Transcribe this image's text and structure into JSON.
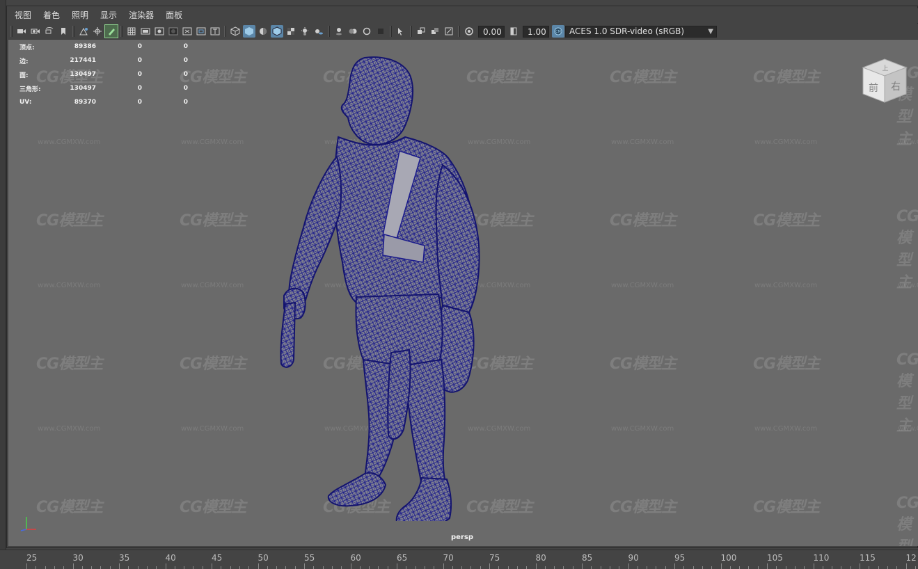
{
  "menubar": {
    "items": [
      "视图",
      "着色",
      "照明",
      "显示",
      "渲染器",
      "面板"
    ]
  },
  "toolbar": {
    "exposure_value": "0.00",
    "gamma_value": "1.00",
    "color_space": "ACES 1.0 SDR-video (sRGB)",
    "icons": [
      "select-camera-icon",
      "camera-attributes-icon",
      "bookmark-icon",
      "image-plane-icon",
      "2d-pan-zoom-icon",
      "grease-pencil-icon",
      "grid-icon",
      "film-gate-icon",
      "resolution-gate-icon",
      "gate-mask-icon",
      "field-chart-icon",
      "safe-action-icon",
      "safe-title-icon",
      "wireframe-icon",
      "smooth-shade-icon",
      "default-material-icon",
      "shaded-wireframe-icon",
      "textured-icon",
      "use-lights-icon",
      "shadows-icon",
      "screen-space-ao-icon",
      "motion-blur-icon",
      "multisample-aa-icon",
      "depth-of-field-icon",
      "isolate-select-icon",
      "xray-icon",
      "xray-joints-icon",
      "backface-culling-icon",
      "exposure-icon",
      "gamma-icon",
      "color-management-icon"
    ]
  },
  "hud": {
    "rows": [
      {
        "label": "顶点:",
        "v1": "89386",
        "v2": "0",
        "v3": "0"
      },
      {
        "label": "边:",
        "v1": "217441",
        "v2": "0",
        "v3": "0"
      },
      {
        "label": "面:",
        "v1": "130497",
        "v2": "0",
        "v3": "0"
      },
      {
        "label": "三角形:",
        "v1": "130497",
        "v2": "0",
        "v3": "0"
      },
      {
        "label": "UV:",
        "v1": "89370",
        "v2": "0",
        "v3": "0"
      }
    ]
  },
  "watermark": {
    "logo": "CG模型主",
    "url": "www.CGMXW.com"
  },
  "viewcube": {
    "front": "前",
    "right": "右",
    "top": "上"
  },
  "camera_label": "persp",
  "timeline": {
    "ticks": [
      "25",
      "30",
      "35",
      "40",
      "45",
      "50",
      "55",
      "60",
      "65",
      "70",
      "75",
      "80",
      "85",
      "90",
      "95",
      "100",
      "105",
      "110",
      "115",
      "12"
    ]
  },
  "colors": {
    "wireframe": "#1c1c8c",
    "viewport_bg": "#6a6a6a",
    "active_icon": "#5b86a8"
  }
}
